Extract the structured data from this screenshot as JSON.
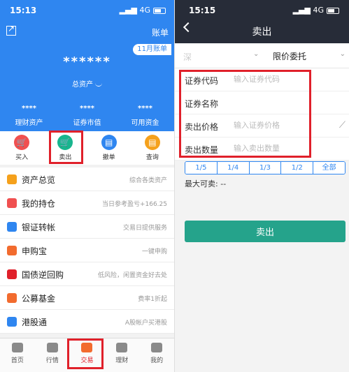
{
  "left": {
    "status": {
      "time": "15:13",
      "network": "4G"
    },
    "header": {
      "bill_link": "账单",
      "month_chip": "11月账单",
      "masked_total": "******",
      "total_label": "总资产"
    },
    "stats": [
      {
        "value": "****",
        "label": "理财资产"
      },
      {
        "value": "****",
        "label": "证券市值"
      },
      {
        "value": "****",
        "label": "可用资金"
      }
    ],
    "actions": [
      {
        "icon": "🛒",
        "label": "买入"
      },
      {
        "icon": "🛒",
        "label": "卖出"
      },
      {
        "icon": "▤",
        "label": "撤单"
      },
      {
        "icon": "▤",
        "label": "查询"
      }
    ],
    "menu": [
      {
        "icon_color": "#f5a11c",
        "label": "资产总览",
        "desc": "综合各类资产"
      },
      {
        "icon_color": "#f05050",
        "label": "我的持仓",
        "desc": "当日参考盈亏+166.25"
      },
      {
        "icon_color": "#2f86f0",
        "label": "银证转帐",
        "desc": "交易日提供服务"
      },
      {
        "icon_color": "#f26b2e",
        "label": "申购宝",
        "desc": "一键申购"
      },
      {
        "icon_color": "#e0202a",
        "label": "国债逆回购",
        "desc": "低风险，闲置资金好去处"
      },
      {
        "icon_color": "#f26b2e",
        "label": "公募基金",
        "desc": "费率1折起"
      },
      {
        "icon_color": "#2f86f0",
        "label": "港股通",
        "desc": "A股帐户买港股"
      }
    ],
    "tabs": [
      {
        "label": "首页"
      },
      {
        "label": "行情"
      },
      {
        "label": "交易"
      },
      {
        "label": "理财"
      },
      {
        "label": "我的"
      }
    ]
  },
  "right": {
    "status": {
      "time": "15:15",
      "network": "4G"
    },
    "title": "卖出",
    "market_select": "深",
    "order_type": "限价委托",
    "form": {
      "code_label": "证券代码",
      "code_placeholder": "输入证券代码",
      "name_label": "证券名称",
      "price_label": "卖出价格",
      "price_placeholder": "输入证券价格",
      "qty_label": "卖出数量",
      "qty_placeholder": "输入卖出数量"
    },
    "fractions": [
      "1/5",
      "1/4",
      "1/3",
      "1/2",
      "全部"
    ],
    "max_sell_label": "最大可卖:",
    "max_sell_value": "--",
    "sell_button": "卖出"
  },
  "colors": {
    "header_blue": "#2f86f0",
    "sell_green": "#25a38b",
    "highlight_red": "#e0202a",
    "dark_header": "#272c38"
  }
}
